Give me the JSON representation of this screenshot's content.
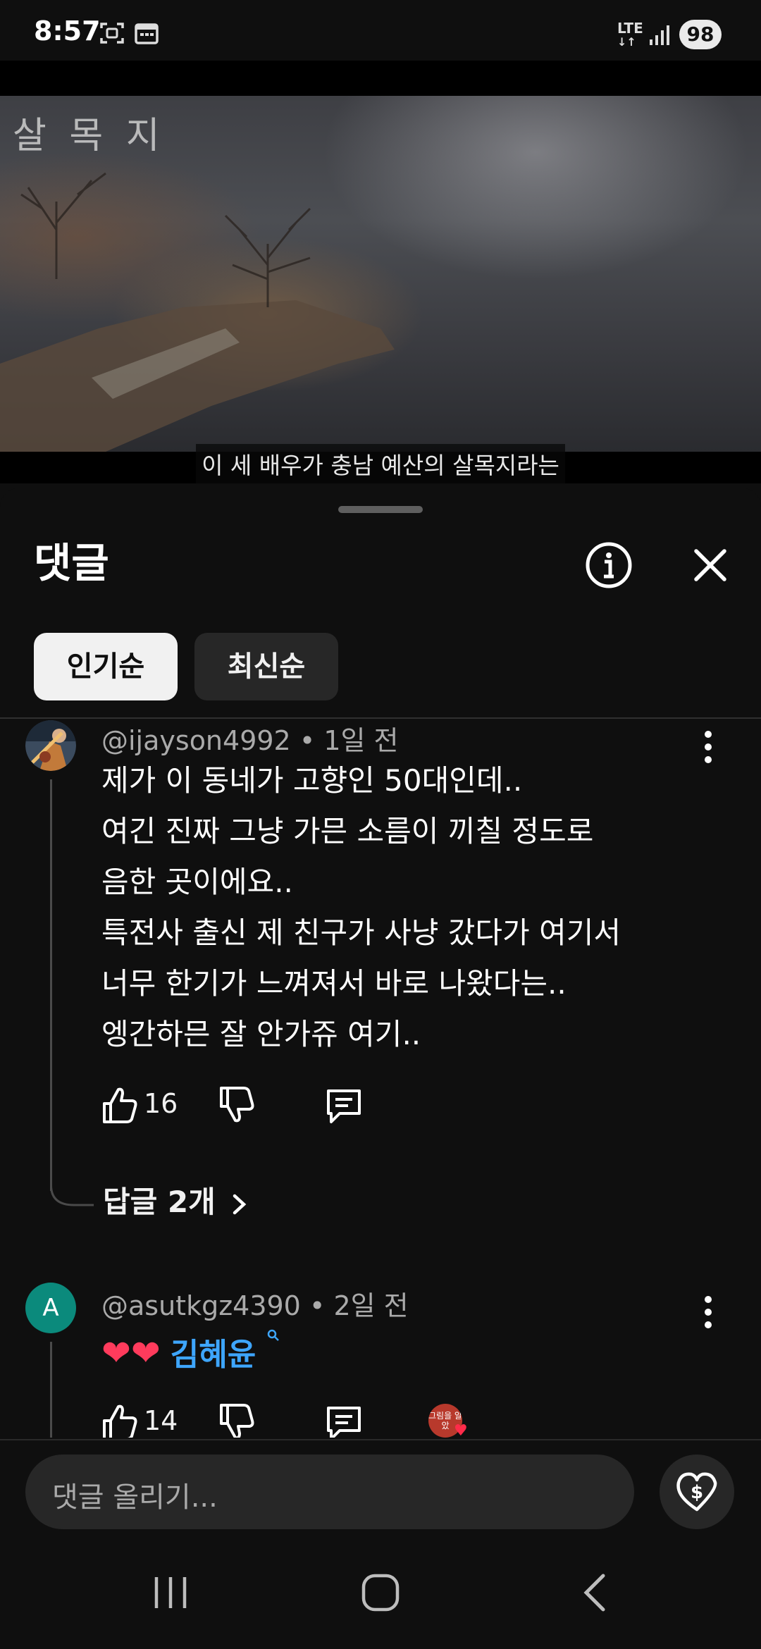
{
  "status_bar": {
    "time": "8:57",
    "network": "LTE",
    "battery": "98",
    "icons": [
      "screenshot-icon",
      "calendar-icon",
      "lte-icon",
      "signal-icon",
      "battery-icon"
    ]
  },
  "video": {
    "title_overlay": "살 목 지",
    "subtitle": "이 세 배우가 충남 예산의 살목지라는"
  },
  "comments_sheet": {
    "title": "댓글",
    "sort_chips": [
      {
        "label": "인기순",
        "selected": true
      },
      {
        "label": "최신순",
        "selected": false
      }
    ],
    "comments": [
      {
        "author": "@ijayson4992",
        "time": "• 1일 전",
        "lines": [
          "제가 이 동네가 고향인 50대인데..",
          "여긴 진짜 그냥 가믄 소름이 끼칠 정도로",
          "음한 곳이에요..",
          "특전사 출신 제 친구가 사냥 갔다가 여기서",
          "너무 한기가 느껴져서 바로 나왔다는..",
          "엥간하믄 잘 안가쥬 여기.."
        ],
        "likes": "16",
        "replies_label": "답글 2개"
      },
      {
        "author": "@asutkgz4390",
        "time": "• 2일 전",
        "avatar_letter": "A",
        "hearts": "❤❤",
        "mention": "김혜윤",
        "likes": "14",
        "creator_heart_badge": "그림을 알았"
      }
    ]
  },
  "comment_input": {
    "placeholder": "댓글 올리기..."
  },
  "colors": {
    "background": "#0f0f0f",
    "chip_active": "#f1f1f1",
    "chip_inactive": "#272727",
    "link": "#3ea6ff",
    "heart": "#ff3b5c",
    "avatar_a": "#0b8a7c"
  }
}
